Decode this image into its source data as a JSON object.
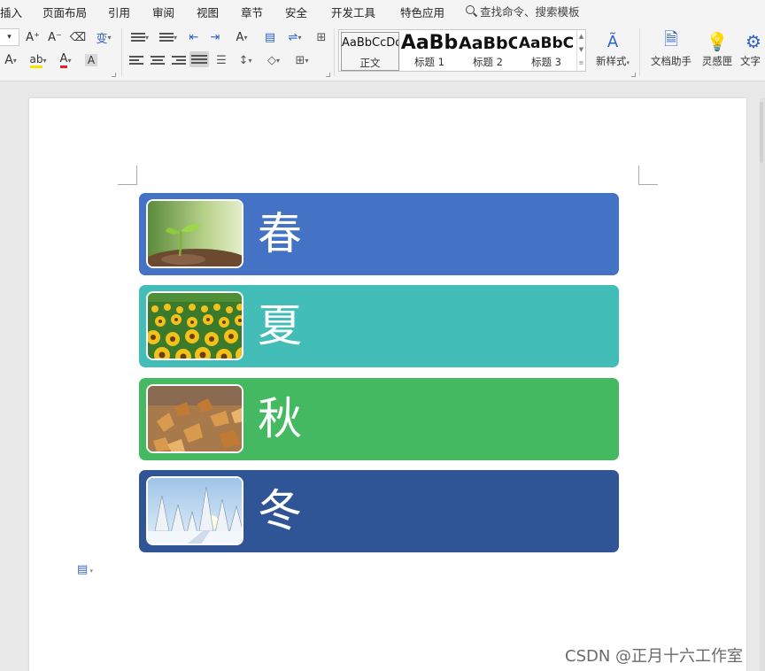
{
  "menu": {
    "items": [
      "插入",
      "页面布局",
      "引用",
      "审阅",
      "视图",
      "章节",
      "安全",
      "开发工具",
      "特色应用"
    ],
    "search": "查找命令、搜索模板"
  },
  "ribbon": {
    "font_row1": [
      "A⁺",
      "A⁻",
      "⌫",
      "变"
    ],
    "styles": [
      {
        "sample": "AaBbCcDd",
        "name": "正文"
      },
      {
        "sample": "AaBb",
        "name": "标题 1"
      },
      {
        "sample": "AaBbC",
        "name": "标题 2"
      },
      {
        "sample": "AaBbC",
        "name": "标题 3"
      }
    ],
    "new_style": "新样式",
    "doc_assistant": "文档助手",
    "inspiration": "灵感匣",
    "text_tool": "文字"
  },
  "document": {
    "seasons": [
      {
        "label": "春",
        "color": "#4472c4",
        "image": "sprout-photo"
      },
      {
        "label": "夏",
        "color": "#42bdb8",
        "image": "sunflower-field-photo"
      },
      {
        "label": "秋",
        "color": "#45b962",
        "image": "autumn-leaves-photo"
      },
      {
        "label": "冬",
        "color": "#2f5597",
        "image": "snowy-forest-photo"
      }
    ]
  },
  "watermark": "CSDN @正月十六工作室"
}
